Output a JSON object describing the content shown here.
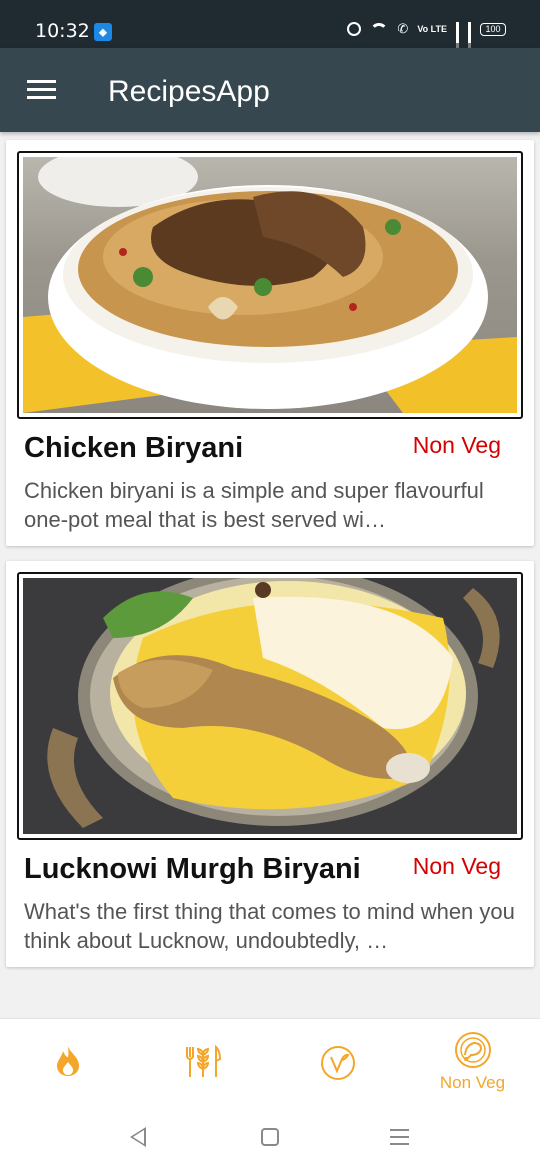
{
  "status_bar": {
    "time": "10:32",
    "battery": "100",
    "volte": "Vo LTE"
  },
  "app_bar": {
    "title": "RecipesApp",
    "menu_icon": "hamburger-menu-icon"
  },
  "recipes": [
    {
      "title": "Chicken Biryani",
      "tag": "Non Veg",
      "description": "Chicken biryani is a simple and super flavourful one-pot meal that is best served wi…"
    },
    {
      "title": "Lucknowi Murgh Biryani",
      "tag": "Non Veg",
      "description": "What's the first thing that comes to mind when you think about Lucknow, undoubtedly, …"
    }
  ],
  "bottom_nav": {
    "items": [
      {
        "icon": "flame-icon",
        "label": ""
      },
      {
        "icon": "fork-wheat-knife-icon",
        "label": ""
      },
      {
        "icon": "veg-leaf-icon",
        "label": ""
      },
      {
        "icon": "chicken-plate-icon",
        "label": "Non Veg"
      }
    ]
  },
  "colors": {
    "app_bar": "#37474f",
    "status_bar": "#1f2a31",
    "accent": "#f4a62a",
    "tag_red": "#d50000"
  }
}
